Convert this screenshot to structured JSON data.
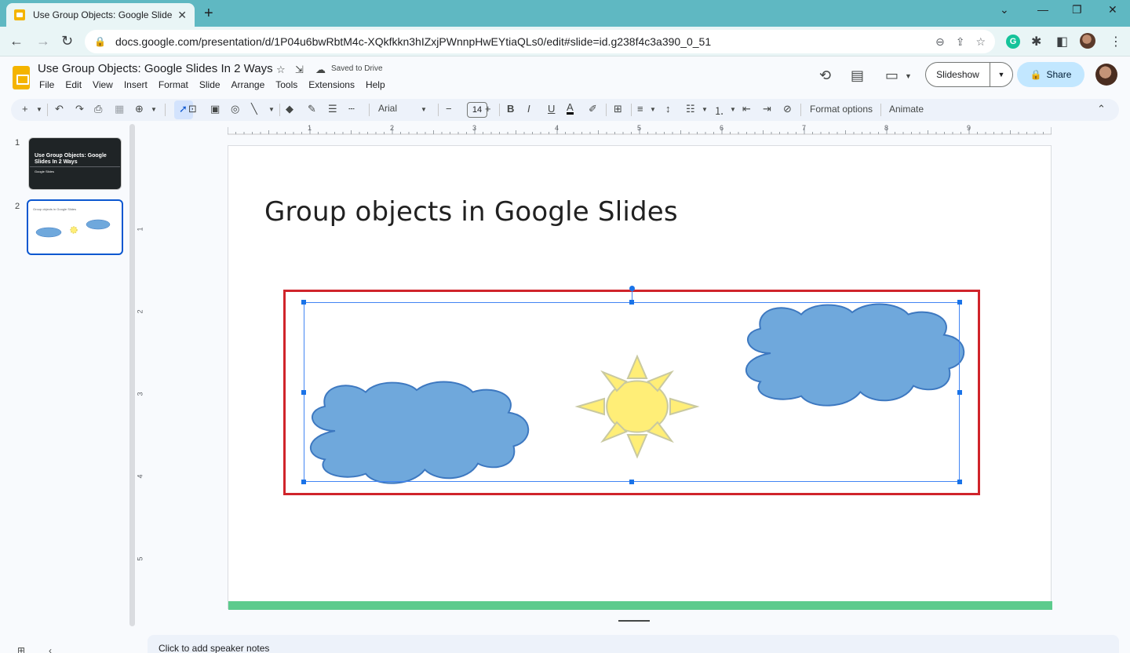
{
  "browser": {
    "tab_title": "Use Group Objects: Google Slide",
    "url": "docs.google.com/presentation/d/1P04u6bwRbtM4c-XQkfkkn3hIZxjPWnnpHwEYtiaQLs0/edit#slide=id.g238f4c3a390_0_51"
  },
  "doc": {
    "title": "Use Group Objects: Google Slides In 2 Ways",
    "saved_status": "Saved to Drive",
    "menu": [
      "File",
      "Edit",
      "View",
      "Insert",
      "Format",
      "Slide",
      "Arrange",
      "Tools",
      "Extensions",
      "Help"
    ],
    "slideshow_label": "Slideshow",
    "share_label": "Share"
  },
  "toolbar": {
    "font": "Arial",
    "font_size": "14",
    "format_options": "Format options",
    "animate": "Animate"
  },
  "filmstrip": {
    "slides": [
      {
        "num": "1",
        "title": "Use Group Objects: Google Slides In 2 Ways",
        "subtitle": "Google Slides"
      },
      {
        "num": "2",
        "title": "Group objects in Google Slides"
      }
    ]
  },
  "ruler": {
    "h": [
      "1",
      "2",
      "3",
      "4",
      "5",
      "6",
      "7",
      "8",
      "9"
    ],
    "v": [
      "1",
      "2",
      "3",
      "4",
      "5"
    ]
  },
  "slide": {
    "title": "Group objects in Google Slides"
  },
  "notes": {
    "placeholder": "Click to add speaker notes"
  },
  "colors": {
    "cloud": "#6fa8dc",
    "cloud_stroke": "#3d78c0",
    "sun": "#ffee77",
    "sun_stroke": "#c9c9a0",
    "highlight": "#d0242b",
    "selection": "#4285f4",
    "band": "#5ccb8d"
  }
}
